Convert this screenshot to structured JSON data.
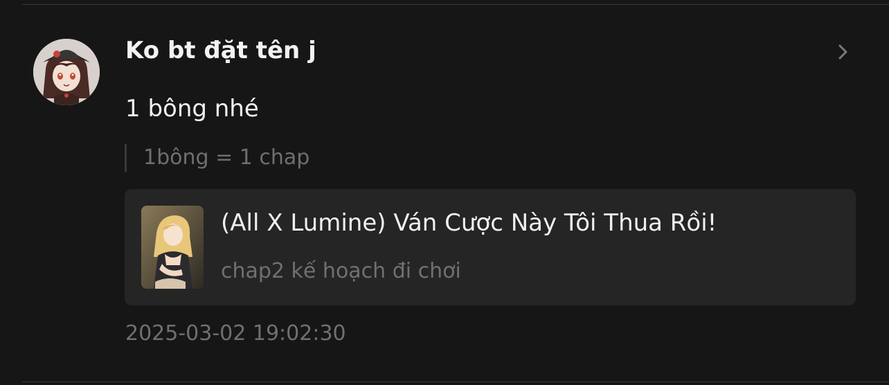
{
  "comment": {
    "username": "Ko bt đặt tên j",
    "message": "1 bông nhé",
    "quote": "1bông = 1 chap",
    "timestamp": "2025-03-02 19:02:30"
  },
  "story_card": {
    "title": "(All X Lumine) Ván Cược Này Tôi Thua Rồi!",
    "chapter": "chap2 kế hoạch đi chơi"
  },
  "icons": {
    "chevron": "chevron-right-icon",
    "avatar": "avatar-image",
    "cover": "story-cover-image"
  },
  "colors": {
    "background": "#161616",
    "card": "#252525",
    "text_primary": "#f2f2f2",
    "text_muted": "#707070"
  }
}
